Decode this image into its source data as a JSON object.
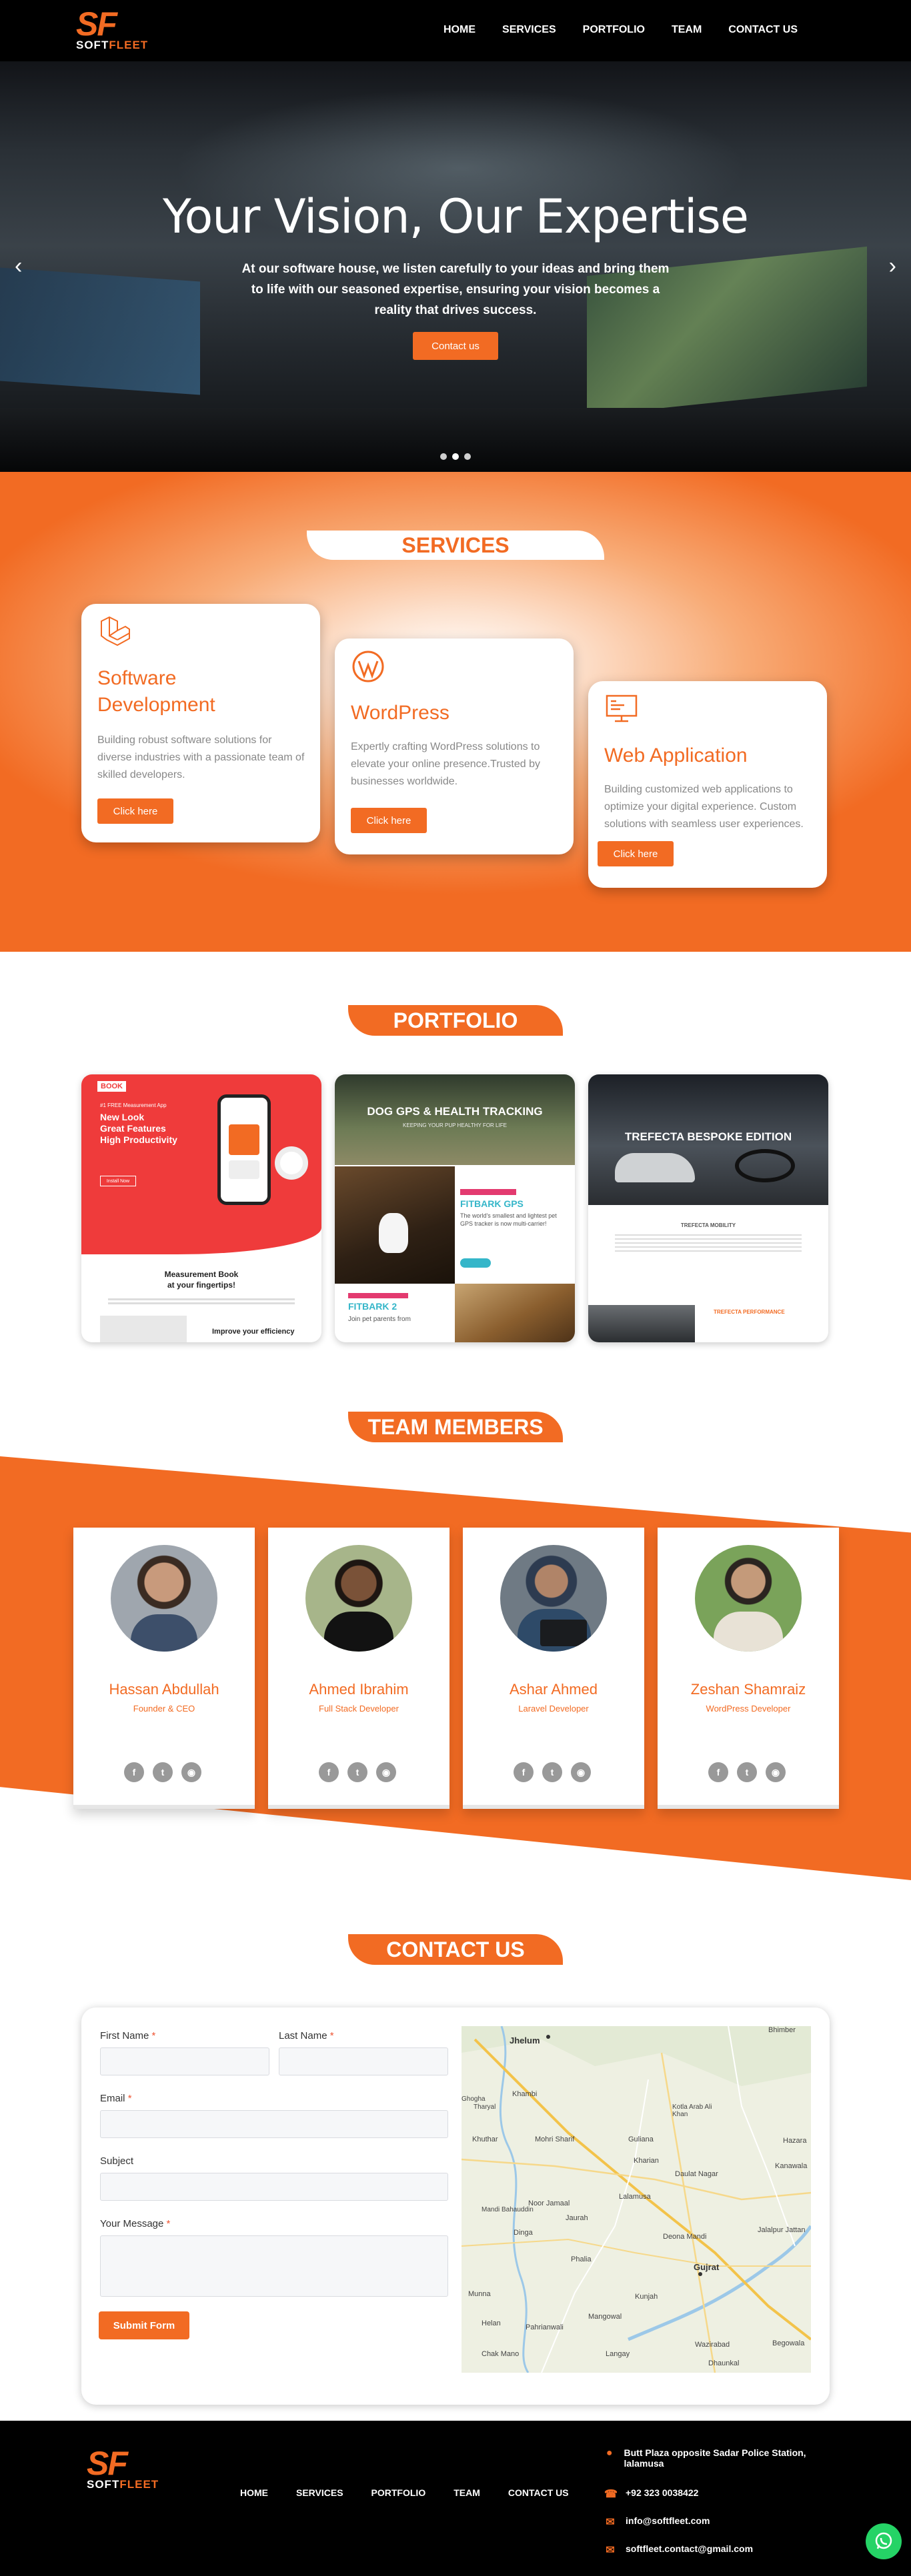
{
  "brand": {
    "mark": "SF",
    "name_part1": "SOFT",
    "name_part2": "FLEET"
  },
  "nav": {
    "items": [
      "HOME",
      "SERVICES",
      "PORTFOLIO",
      "TEAM",
      "CONTACT US"
    ]
  },
  "hero": {
    "title": "Your Vision, Our Expertise",
    "subtitle": "At our software house, we listen carefully to your ideas and bring them to life with our seasoned expertise, ensuring your vision becomes a reality that drives success.",
    "button": "Contact us",
    "slides": 3,
    "active_slide": 1
  },
  "services": {
    "heading": "SERVICES",
    "cards": [
      {
        "icon": "laravel-icon",
        "title": "Software Development",
        "text": "Building robust software solutions for diverse industries with a passionate team of skilled developers.",
        "button": "Click here"
      },
      {
        "icon": "wordpress-icon",
        "title": "WordPress",
        "text": "Expertly crafting WordPress solutions to elevate your online presence.Trusted by businesses worldwide.",
        "button": "Click here"
      },
      {
        "icon": "web-application-icon",
        "title": "Web Application",
        "text": "Building customized web applications to optimize your digital experience.  Custom solutions with seamless user experiences.",
        "button": "Click here"
      }
    ]
  },
  "portfolio": {
    "heading": "PORTFOLIO",
    "items": [
      {
        "logo": "BOOK",
        "tagline": "#1 FREE Measurement App",
        "headline": [
          "New Look",
          "Great Features",
          "High Productivity"
        ],
        "cta": "Install Now",
        "section_title": [
          "Measurement Book",
          "at your fingertips!"
        ],
        "feature": "Improve your efficiency"
      },
      {
        "headline": "DOG GPS & HEALTH TRACKING",
        "subheadline": "KEEPING YOUR PUP HEALTHY FOR LIFE",
        "product1": "FITBARK GPS",
        "product1_text": "The world's smallest and lightest pet GPS tracker is now multi-carrier!",
        "product2": "FITBARK 2",
        "product2_text": "Join pet parents from"
      },
      {
        "headline": "TREFECTA BESPOKE EDITION",
        "subtitle": "TREFECTA MOBILITY",
        "section": "TREFECTA PERFORMANCE"
      }
    ]
  },
  "team": {
    "heading": "TEAM MEMBERS",
    "members": [
      {
        "name": "Hassan Abdullah",
        "role": "Founder & CEO"
      },
      {
        "name": "Ahmed Ibrahim",
        "role": "Full Stack Developer"
      },
      {
        "name": "Ashar Ahmed",
        "role": "Laravel Developer"
      },
      {
        "name": "Zeshan Shamraiz",
        "role": "WordPress Developer"
      }
    ]
  },
  "contact": {
    "heading": "CONTACT US",
    "first_name_label": "First Name",
    "last_name_label": "Last Name",
    "email_label": "Email",
    "subject_label": "Subject",
    "message_label": "Your Message",
    "required_mark": "*",
    "submit": "Submit Form",
    "map_labels": [
      "Jhelum",
      "Bhimber",
      "Kharian",
      "Gujrat",
      "Lalamusa",
      "Dinga",
      "Jalalpur Jattan",
      "Mandi Bahauddin",
      "Wazirabad",
      "Begowala",
      "Kotla Arab Ali Khan",
      "Hazara",
      "Kanawala",
      "Daulat Nagar",
      "Deona Mandi",
      "Guliana",
      "Jaurah",
      "Mohri Sharif",
      "Khuthar",
      "Noor Jamaal",
      "Phalia",
      "Pahrianwali",
      "Mangowal",
      "Chak Mano",
      "Helan",
      "Langay",
      "Dhaunkal",
      "Kunjah",
      "Munna",
      "Khambi",
      "Tharyal",
      "Ghogha"
    ]
  },
  "footer": {
    "links": [
      "HOME",
      "SERVICES",
      "PORTFOLIO",
      "TEAM",
      "CONTACT US"
    ],
    "address": "Butt Plaza opposite Sadar Police Station, lalamusa",
    "phone": "+92 323 0038422",
    "email1": "info@softfleet.com",
    "email2": "softfleet.contact@gmail.com"
  },
  "colors": {
    "accent": "#f26b23",
    "dark": "#000000",
    "whatsapp": "#25d366"
  }
}
